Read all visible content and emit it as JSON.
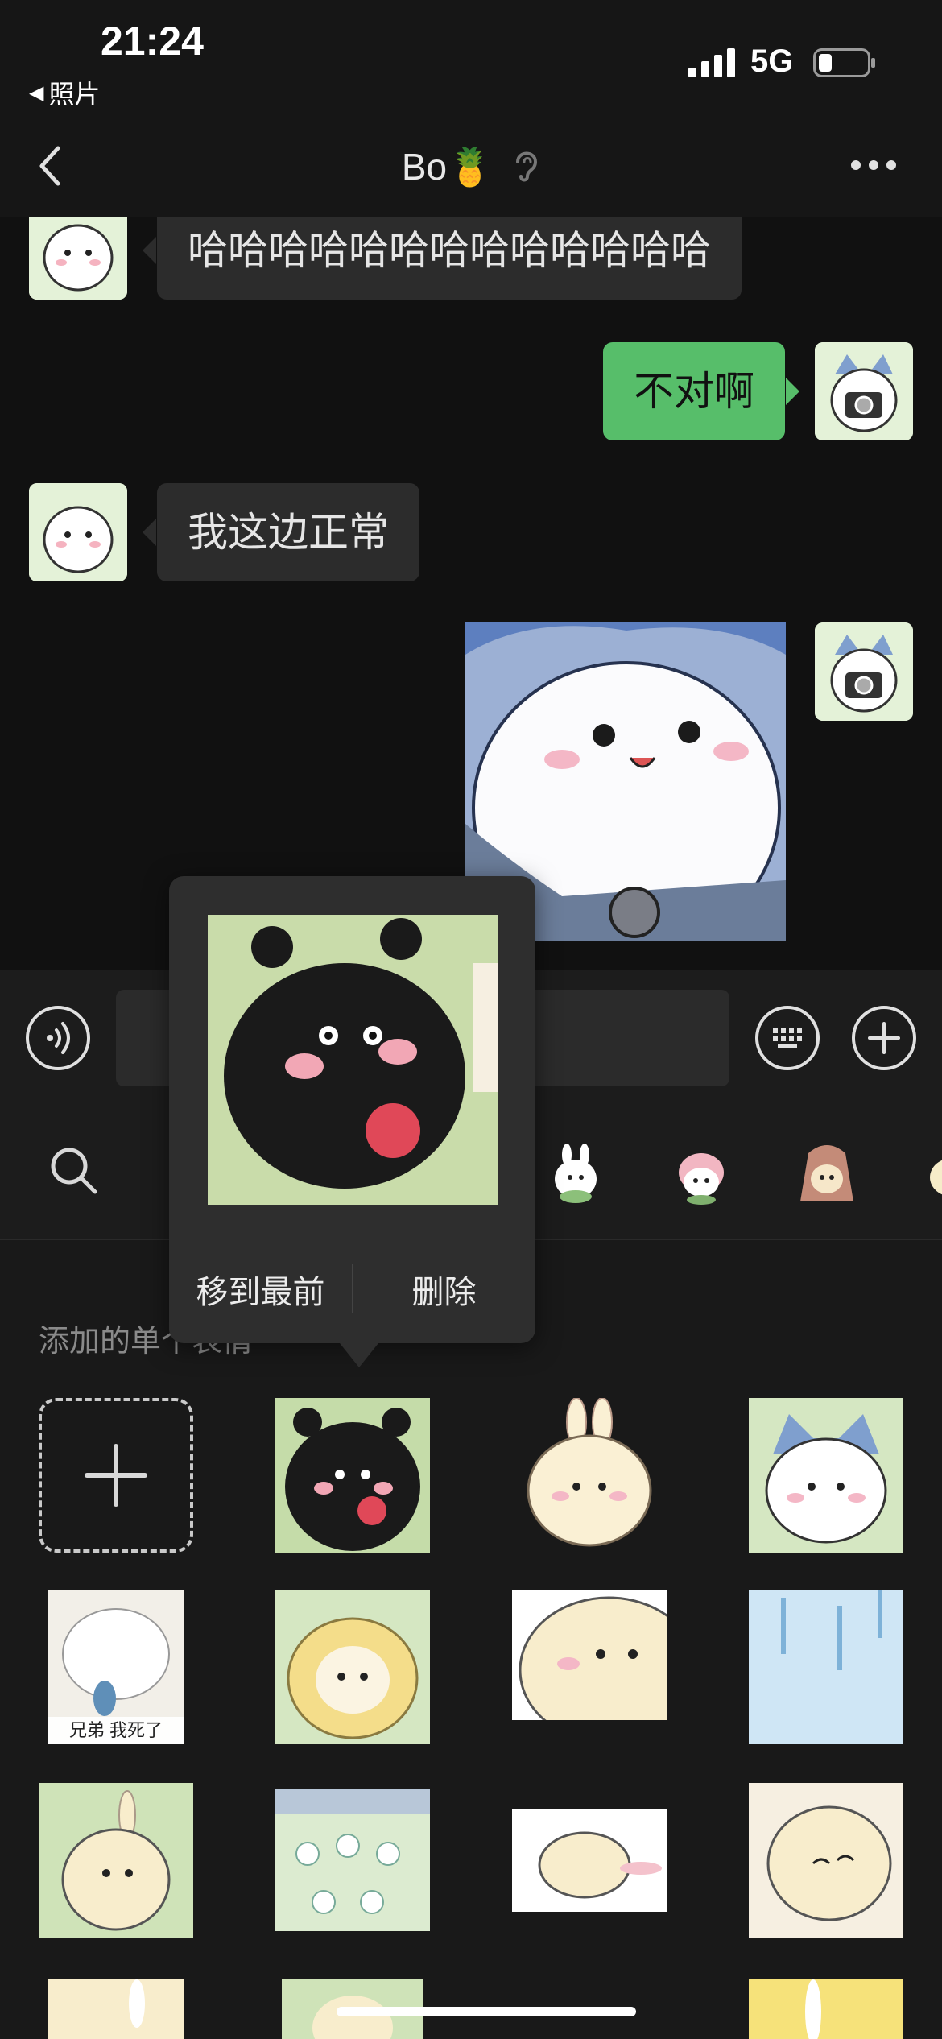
{
  "status": {
    "time": "21:24",
    "back_app": "照片",
    "network": "5G",
    "icons": [
      "signal-icon",
      "battery-icon"
    ]
  },
  "nav": {
    "title": "Bo🍍",
    "icons": [
      "back-chevron-icon",
      "ear-icon",
      "more-icon"
    ]
  },
  "messages": [
    {
      "side": "in",
      "text": "哈哈哈哈哈哈哈哈哈哈哈哈哈"
    },
    {
      "side": "out",
      "text": "不对啊"
    },
    {
      "side": "in",
      "text": "我这边正常"
    },
    {
      "side": "out",
      "type": "sticker"
    }
  ],
  "input": {
    "icons": [
      "voice-icon",
      "keyboard-icon",
      "plus-circle-icon"
    ]
  },
  "tabs": {
    "icons": [
      "search-icon",
      "sticker-tab-1",
      "sticker-tab-2",
      "sticker-tab-3",
      "sticker-tab-4"
    ]
  },
  "panel": {
    "title": "添加的单个表情",
    "sticker_caption": "兄弟 我死了"
  },
  "popup": {
    "move_to_front": "移到最前",
    "delete": "删除"
  },
  "colors": {
    "background": "#111111",
    "bubble_out": "#57be6a",
    "bubble_in": "#2c2c2c"
  }
}
